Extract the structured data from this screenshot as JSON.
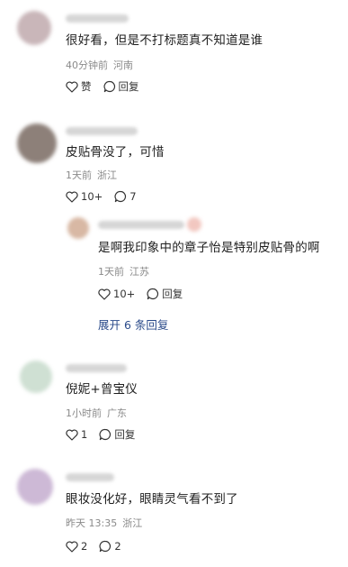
{
  "comments": [
    {
      "text": "很好看，但是不打标题真不知道是谁",
      "time": "40分钟前",
      "location": "河南",
      "like_label": "赞",
      "reply_label": "回复",
      "avatar_color": "#c9b6b9"
    },
    {
      "text": "皮贴骨没了，可惜",
      "time": "1天前",
      "location": "浙江",
      "like_label": "10+",
      "reply_label": "7",
      "avatar_color": "#8d8079"
    },
    {
      "text": "是啊我印象中的章子怡是特别皮贴骨的啊",
      "time": "1天前",
      "location": "江苏",
      "like_label": "10+",
      "reply_label": "回复",
      "avatar_color": "#d8b8a4",
      "badge_color": "#f2c7c0"
    },
    {
      "text": "倪妮+曾宝仪",
      "time": "1小时前",
      "location": "广东",
      "like_label": "1",
      "reply_label": "回复",
      "avatar_color": "#cfe0d3"
    },
    {
      "text": "眼妆没化好，眼睛灵气看不到了",
      "time": "昨天 13:35",
      "location": "浙江",
      "like_label": "2",
      "reply_label": "2",
      "avatar_color": "#cdb9d6"
    }
  ],
  "expand_label": "展开 6 条回复",
  "icons": {
    "like": "heart-outline-icon",
    "reply": "speech-bubble-icon"
  },
  "colors": {
    "text": "#1f1f1f",
    "meta": "#8a8a8a",
    "link": "#2a4a8a"
  }
}
